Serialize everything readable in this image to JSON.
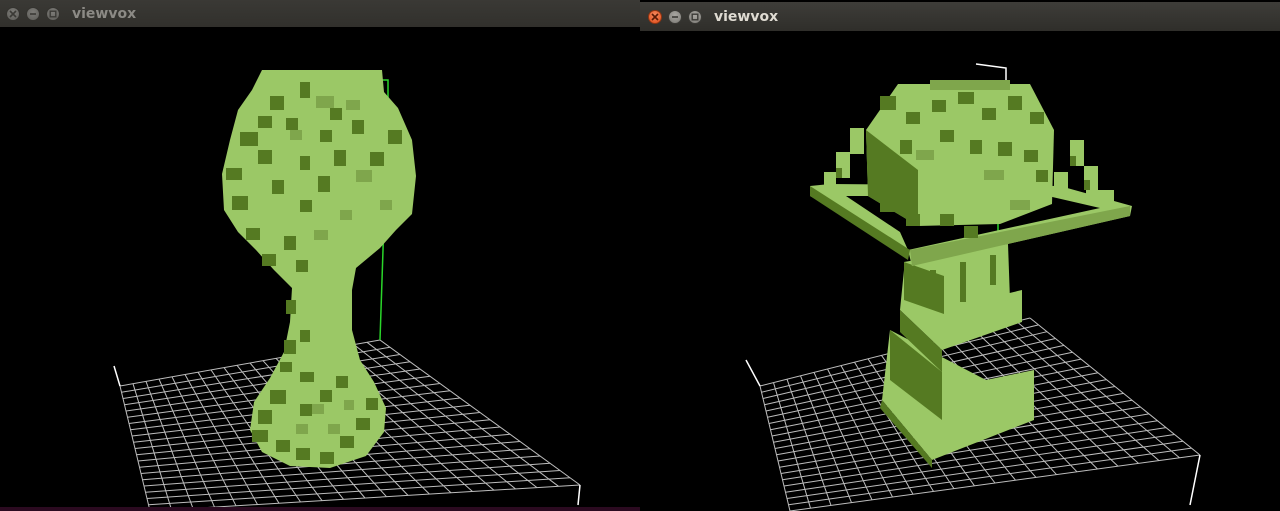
{
  "windows": [
    {
      "title": "viewvox",
      "state": "inactive",
      "view": "goblet-front"
    },
    {
      "title": "viewvox",
      "state": "active",
      "view": "tray-angled"
    }
  ],
  "colors": {
    "voxel_light": "#9bc866",
    "voxel_mid": "#7fa64c",
    "voxel_dark": "#557a22",
    "grid": "#bdbdbd",
    "axis": "#2ad62a",
    "background": "#000000"
  },
  "icons": [
    "close-icon",
    "minimize-icon",
    "maximize-icon"
  ]
}
